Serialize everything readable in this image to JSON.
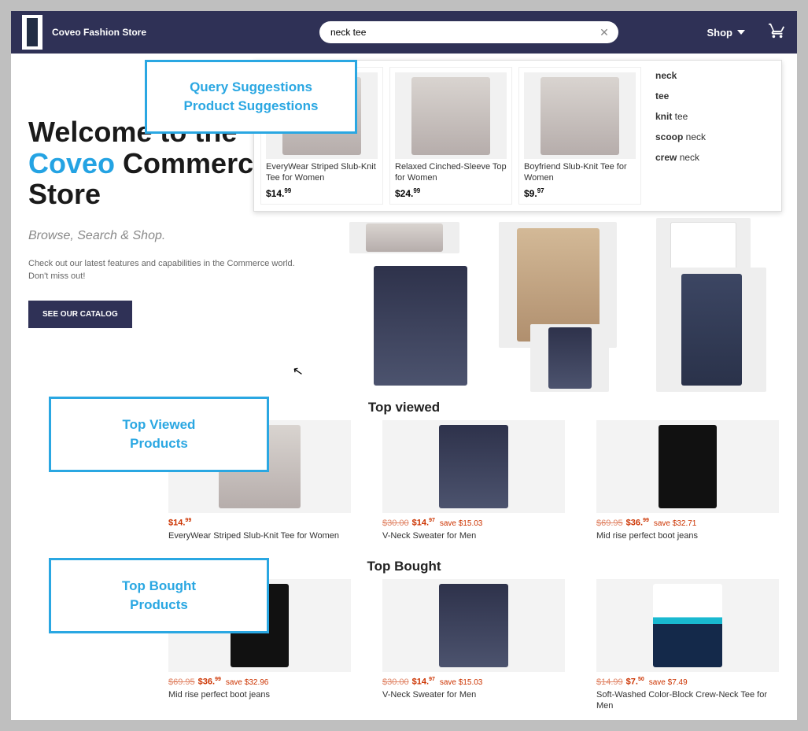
{
  "header": {
    "brand": "Coveo Fashion Store",
    "search_value": "neck tee",
    "shop_label": "Shop"
  },
  "suggestions": {
    "products": [
      {
        "title": "EveryWear Striped Slub-Knit Tee for Women",
        "price_whole": "$14.",
        "price_cents": "99"
      },
      {
        "title": "Relaxed Cinched-Sleeve Top for Women",
        "price_whole": "$24.",
        "price_cents": "99"
      },
      {
        "title": "Boyfriend Slub-Knit Tee for Women",
        "price_whole": "$9.",
        "price_cents": "97"
      }
    ],
    "queries": [
      {
        "pre": "",
        "bold": "neck",
        "post": ""
      },
      {
        "pre": "",
        "bold": "tee",
        "post": ""
      },
      {
        "pre": "knit",
        "bold": " tee",
        "post": ""
      },
      {
        "pre": "scoop",
        "bold": " neck",
        "post": ""
      },
      {
        "pre": "crew",
        "bold": " neck",
        "post": ""
      }
    ]
  },
  "hero": {
    "title_line1_a": "Welcome to the",
    "title_line2_accent": "Coveo",
    "title_line2_b": " Commerce",
    "title_line3": "Store",
    "tagline": "Browse, Search & Shop.",
    "subtext": "Check out our latest features and capabilities in the Commerce world.",
    "subtext2": "Don't miss out!",
    "cta": "SEE OUR CATALOG"
  },
  "annotations": {
    "a1_l1": "Query Suggestions",
    "a1_l2": "Product Suggestions",
    "a2_l1": "Top Viewed",
    "a2_l2": "Products",
    "a3_l1": "Top Bought",
    "a3_l2": "Products"
  },
  "sections": {
    "top_viewed_head": "Top viewed",
    "top_bought_head": "Top Bought"
  },
  "top_viewed": [
    {
      "strike": "",
      "price": "$14.",
      "cents": "99",
      "save": "",
      "name": "EveryWear Striped Slub-Knit Tee for Women"
    },
    {
      "strike": "$30.00",
      "price": "$14.",
      "cents": "97",
      "save": "save $15.03",
      "name": "V-Neck Sweater for Men"
    },
    {
      "strike": "$69.95",
      "price": "$36.",
      "cents": "99",
      "save": "save $32.71",
      "name": "Mid rise perfect boot jeans"
    }
  ],
  "top_bought": [
    {
      "strike": "$69.95",
      "price": "$36.",
      "cents": "99",
      "save": "save $32.96",
      "name": "Mid rise perfect boot jeans"
    },
    {
      "strike": "$30.00",
      "price": "$14.",
      "cents": "97",
      "save": "save $15.03",
      "name": "V-Neck Sweater for Men"
    },
    {
      "strike": "$14.99",
      "price": "$7.",
      "cents": "50",
      "save": "save $7.49",
      "name": "Soft-Washed Color-Block Crew-Neck Tee for Men"
    }
  ]
}
